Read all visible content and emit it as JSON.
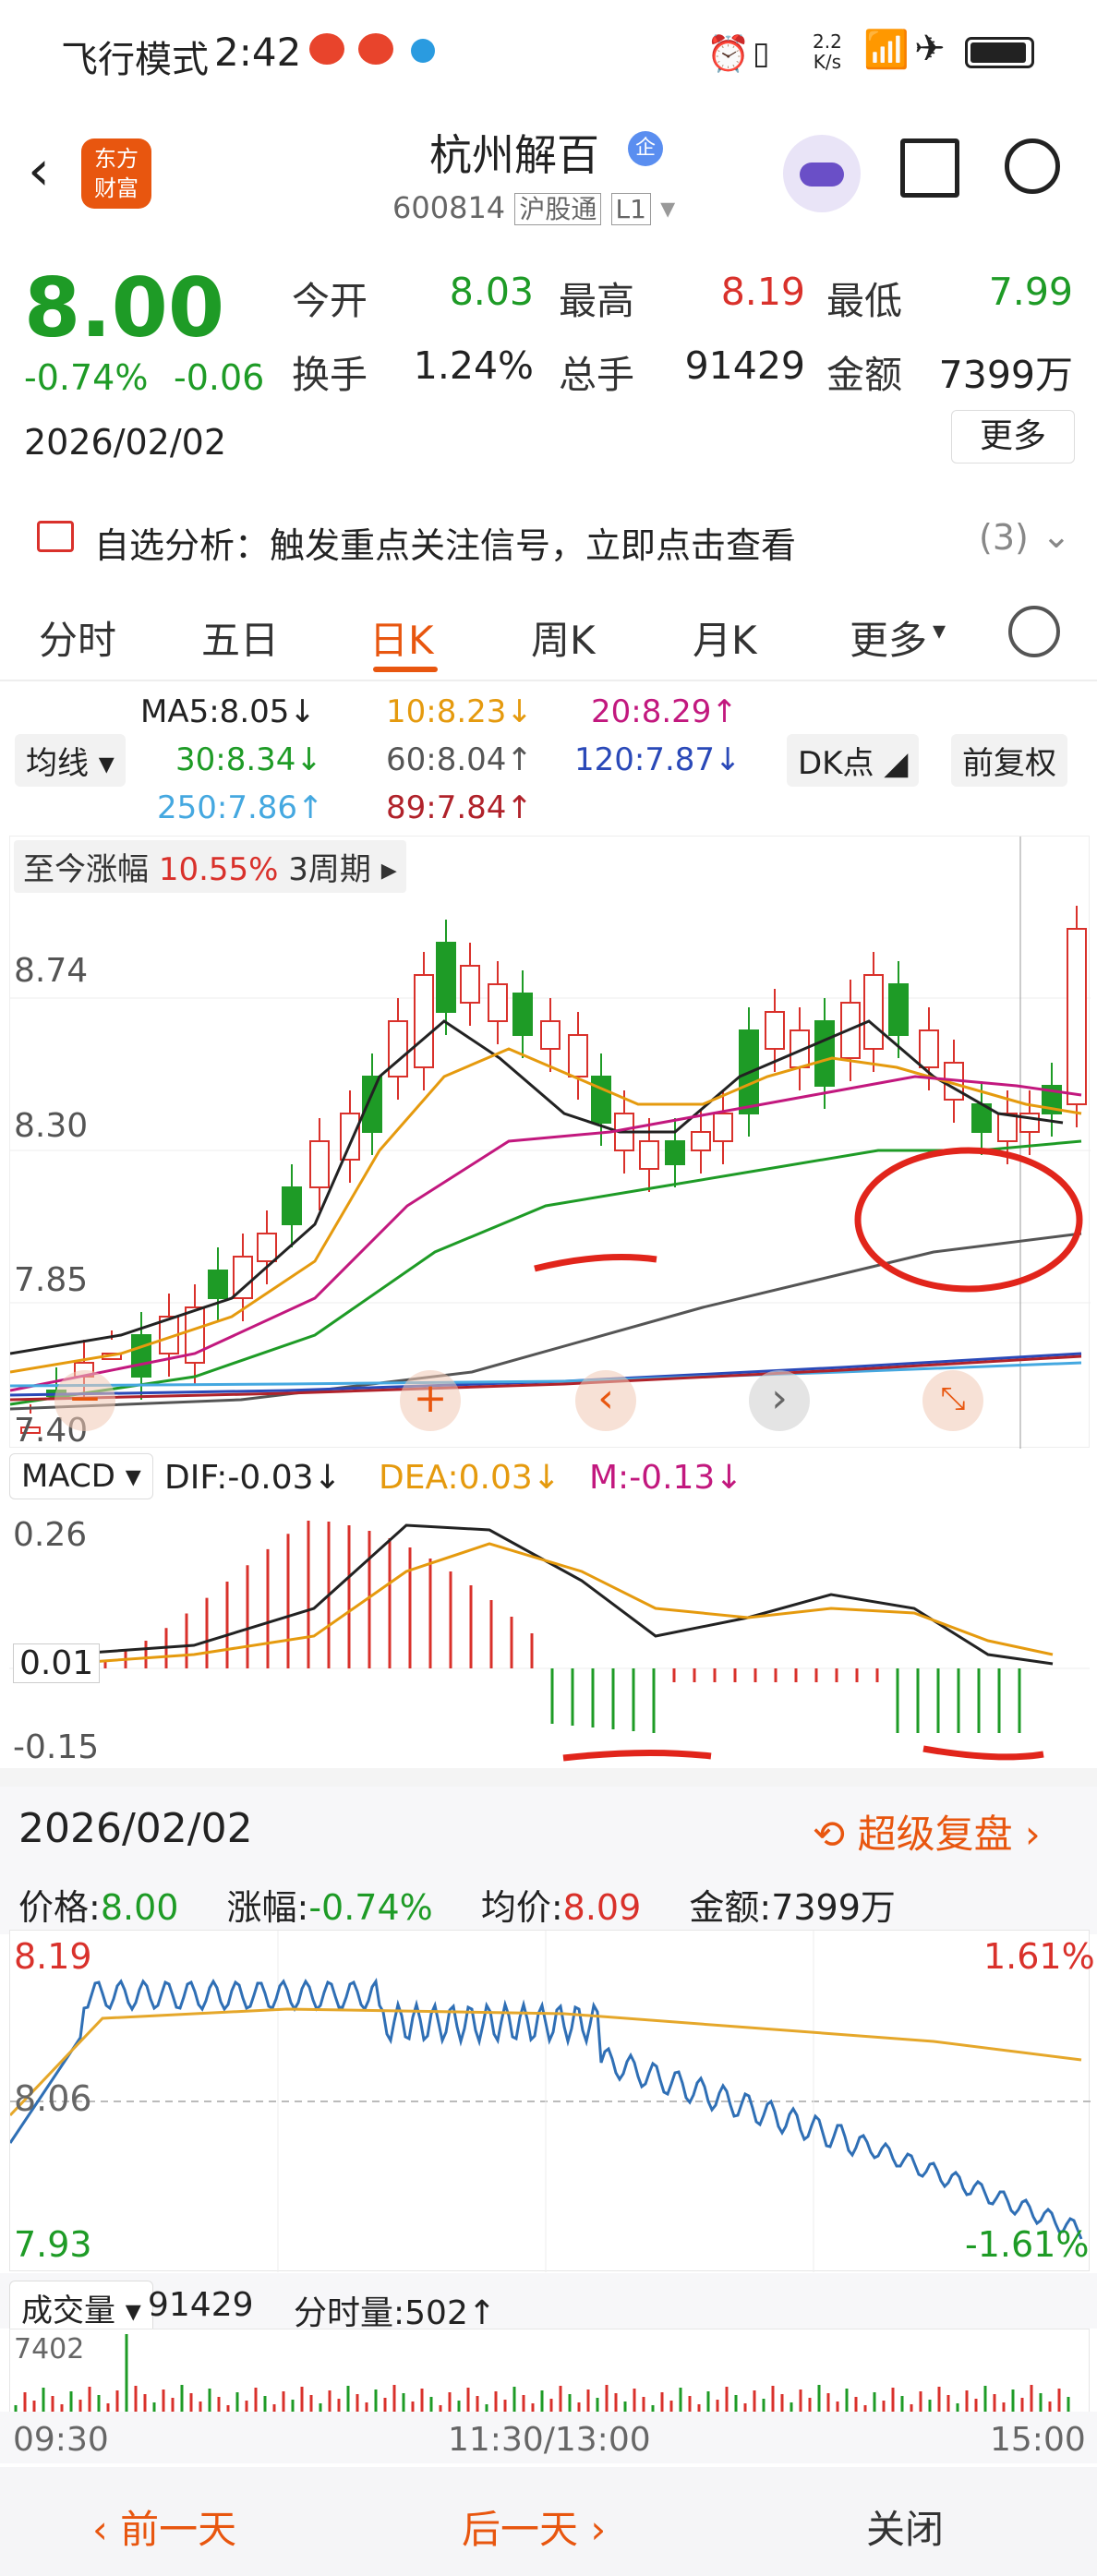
{
  "status": {
    "mode": "飞行模式",
    "time": "2:42",
    "net_speed_top": "2.2",
    "net_speed_bottom": "K/s",
    "signal_badge": "6"
  },
  "header": {
    "app_logo_line1": "东方",
    "app_logo_line2": "财富",
    "stock_name": "杭州解百",
    "enterprise_badge": "企",
    "code": "600814",
    "exchange": "沪股通",
    "level": "L1"
  },
  "quote": {
    "price": "8.00",
    "change_pct": "-0.74%",
    "change": "-0.06",
    "date": "2026/02/02",
    "stats": [
      {
        "label": "今开",
        "value": "8.03",
        "color": "grn"
      },
      {
        "label": "最高",
        "value": "8.19",
        "color": "red"
      },
      {
        "label": "最低",
        "value": "7.99",
        "color": "grn"
      },
      {
        "label": "换手",
        "value": "1.24%",
        "color": ""
      },
      {
        "label": "总手",
        "value": "91429",
        "color": ""
      },
      {
        "label": "金额",
        "value": "7399万",
        "color": ""
      }
    ],
    "more": "更多"
  },
  "ai": {
    "text": "自选分析：触发重点关注信号，立即点击查看",
    "count": "(3)"
  },
  "tabs": [
    "分时",
    "五日",
    "日K",
    "周K",
    "月K",
    "更多"
  ],
  "active_tab": "日K",
  "ma": {
    "selector": "均线",
    "dk": "DK点",
    "adjust": "前复权",
    "items": [
      {
        "t": "MA5:8.05↓",
        "c": "#222"
      },
      {
        "t": "10:8.23↓",
        "c": "#e59a0e"
      },
      {
        "t": "20:8.29↑",
        "c": "#c2187e"
      },
      {
        "t": "30:8.34↓",
        "c": "#1e9b26"
      },
      {
        "t": "60:8.04↑",
        "c": "#555"
      },
      {
        "t": "120:7.87↓",
        "c": "#2a49b8"
      },
      {
        "t": "250:7.86↑",
        "c": "#45a8e0"
      },
      {
        "t": "89:7.84↑",
        "c": "#b0222a"
      }
    ]
  },
  "range_label": {
    "label": "至今涨幅",
    "value": "10.55%",
    "period": "3周期"
  },
  "kchart": {
    "y_labels": [
      "8.74",
      "8.30",
      "7.85",
      "7.40"
    ]
  },
  "macd": {
    "name": "MACD",
    "dif": "DIF:-0.03↓",
    "dea": "DEA:0.03↓",
    "m": "M:-0.13↓",
    "y_labels": [
      "0.26",
      "0.01",
      "-0.15"
    ]
  },
  "minute": {
    "date": "2026/02/02",
    "replay": "超级复盘",
    "price_label": "价格:",
    "price": "8.00",
    "chg_label": "涨幅:",
    "chg": "-0.74%",
    "avg_label": "均价:",
    "avg": "8.09",
    "amt_label": "金额:",
    "amt": "7399万",
    "high": "8.19",
    "mid": "8.06",
    "low": "7.93",
    "pct_high": "1.61%",
    "pct_low": "-1.61%"
  },
  "volume": {
    "label": "成交量",
    "total": "91429",
    "tick_label": "分时量:",
    "tick": "502↑",
    "max": "7402"
  },
  "time_axis": [
    "09:30",
    "11:30/13:00",
    "15:00"
  ],
  "footer": {
    "prev": "前一天",
    "next": "后一天",
    "close": "关闭"
  },
  "colors": {
    "up": "#d9312b",
    "down": "#1e9b26",
    "accent": "#e8560f"
  }
}
